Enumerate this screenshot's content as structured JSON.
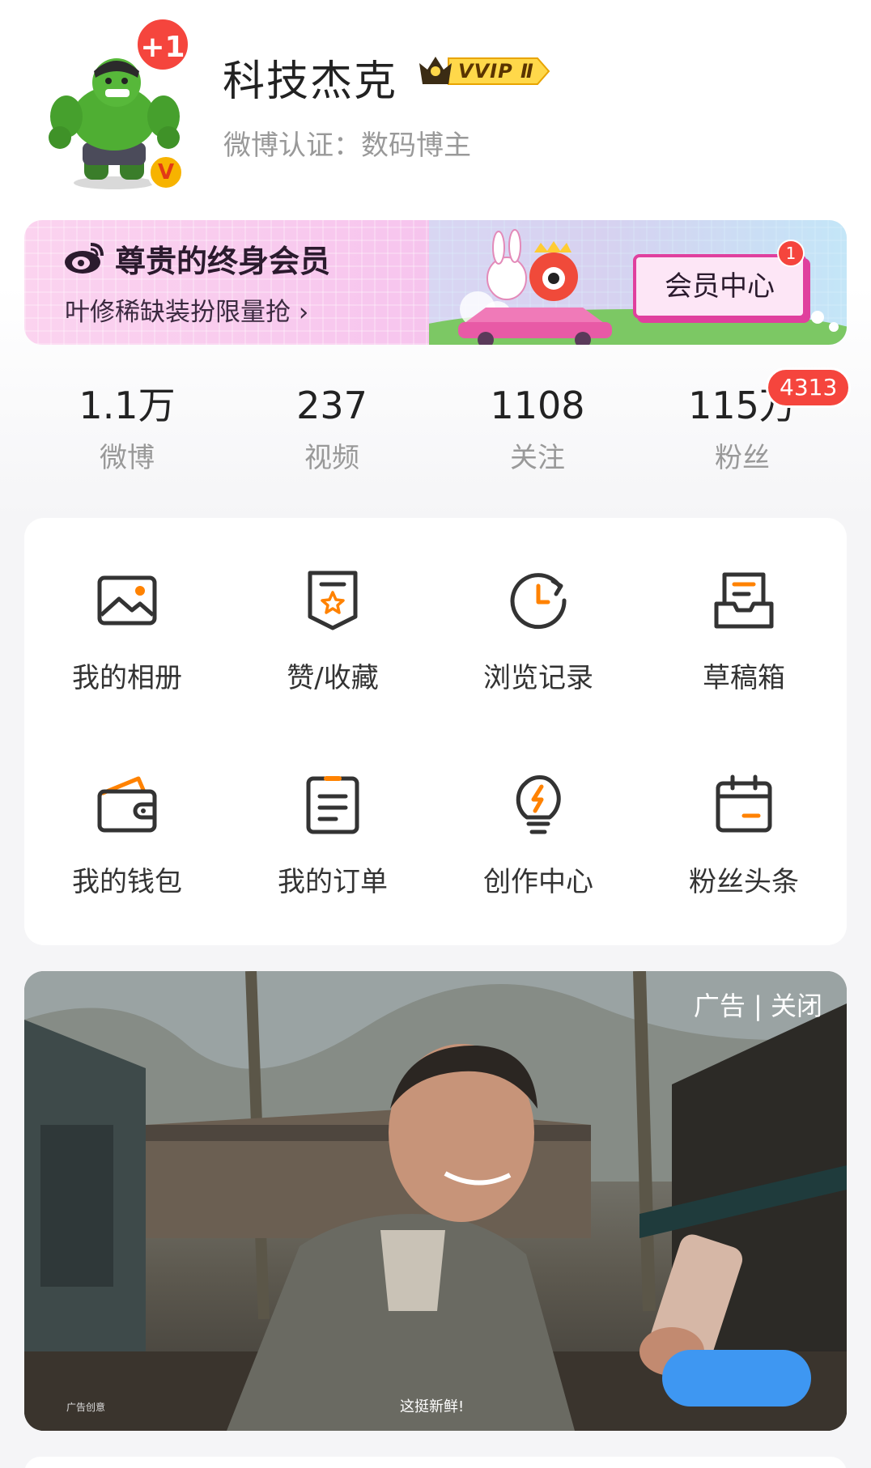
{
  "profile": {
    "username": "科技杰克",
    "vip_label": "VVIP Ⅱ",
    "verification": "微博认证：数码博主",
    "notification_badge": "+1",
    "verified_badge": "V"
  },
  "banner": {
    "title": "尊贵的终身会员",
    "subtitle": "叶修稀缺装扮限量抢 ›",
    "button_label": "会员中心",
    "button_badge": "1"
  },
  "stats": [
    {
      "value": "1.1万",
      "label": "微博"
    },
    {
      "value": "237",
      "label": "视频"
    },
    {
      "value": "1108",
      "label": "关注"
    },
    {
      "value": "115万",
      "label": "粉丝",
      "badge": "4313"
    }
  ],
  "tools": [
    {
      "label": "我的相册",
      "icon": "photo-album-icon"
    },
    {
      "label": "赞/收藏",
      "icon": "favorites-icon"
    },
    {
      "label": "浏览记录",
      "icon": "history-clock-icon"
    },
    {
      "label": "草稿箱",
      "icon": "drafts-tray-icon"
    },
    {
      "label": "我的钱包",
      "icon": "wallet-icon"
    },
    {
      "label": "我的订单",
      "icon": "order-list-icon"
    },
    {
      "label": "创作中心",
      "icon": "lightbulb-icon"
    },
    {
      "label": "粉丝头条",
      "icon": "calendar-icon"
    }
  ],
  "ad": {
    "close_label": "广告 | 关闭",
    "tag": "广告创意",
    "caption": "这挺新鲜!"
  },
  "colors": {
    "accent_orange": "#ff8200",
    "badge_red": "#f5453d",
    "icon_dark": "#333333",
    "ad_button_blue": "#3e97f2"
  }
}
